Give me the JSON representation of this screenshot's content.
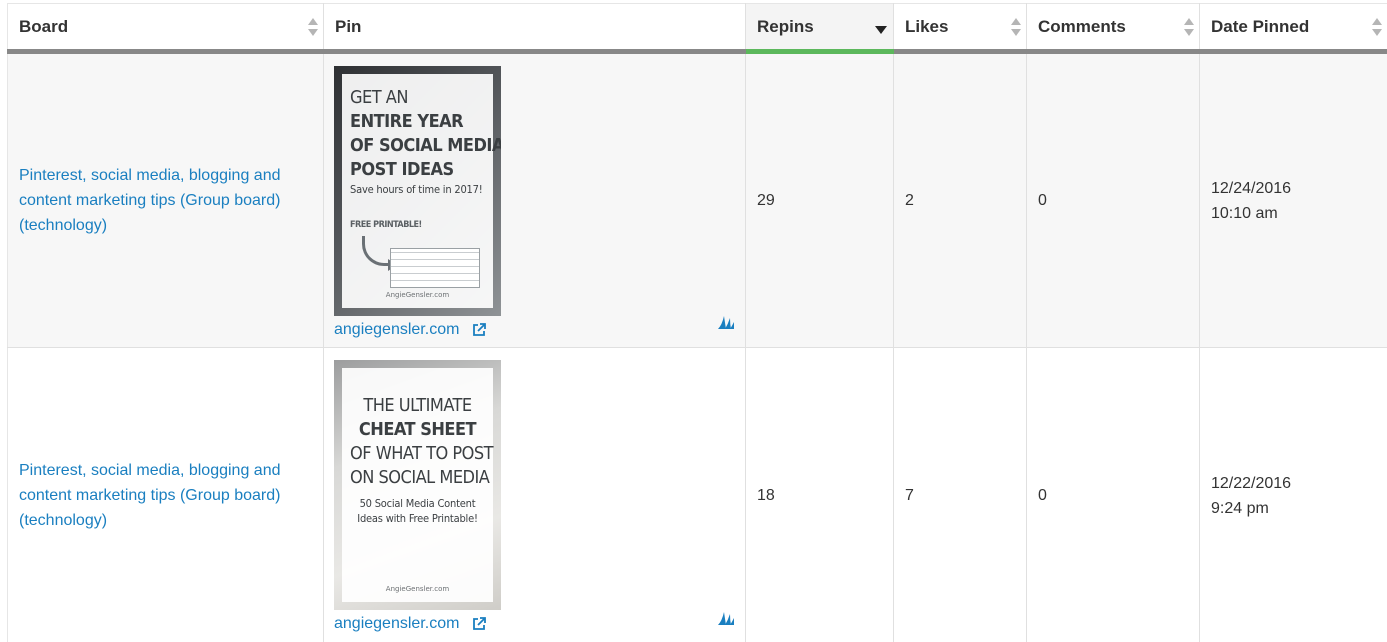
{
  "table": {
    "columns": [
      {
        "label": "Board",
        "sort": "none"
      },
      {
        "label": "Pin",
        "sort": "none"
      },
      {
        "label": "Repins",
        "sort": "desc"
      },
      {
        "label": "Likes",
        "sort": "none"
      },
      {
        "label": "Comments",
        "sort": "none"
      },
      {
        "label": "Date Pinned",
        "sort": "none"
      }
    ],
    "rows": [
      {
        "board": "Pinterest, social media, blogging and content marketing tips (Group board) (technology)",
        "pin": {
          "lines": [
            "GET AN",
            "ENTIRE YEAR",
            "OF SOCIAL MEDIA",
            "POST IDEAS",
            "Save hours of time in 2017!",
            "FREE PRINTABLE!"
          ],
          "credit": "AngieGensler.com",
          "domain": "angiegensler.com"
        },
        "repins": "29",
        "likes": "2",
        "comments": "0",
        "date": "12/24/2016",
        "time": "10:10 am"
      },
      {
        "board": "Pinterest, social media, blogging and content marketing tips (Group board) (technology)",
        "pin": {
          "lines": [
            "THE ULTIMATE",
            "CHEAT SHEET",
            "OF WHAT TO POST",
            "ON SOCIAL MEDIA",
            "50 Social Media Content",
            "Ideas with Free Printable!"
          ],
          "credit": "AngieGensler.com",
          "domain": "angiegensler.com"
        },
        "repins": "18",
        "likes": "7",
        "comments": "0",
        "date": "12/22/2016",
        "time": "9:24 pm"
      }
    ]
  },
  "colors": {
    "link": "#1a7fc0",
    "sorted_underline": "#5cb85c",
    "header_underline": "#888888"
  },
  "icons": {
    "sort": "sort-arrows-icon",
    "sort_desc": "sort-desc-icon",
    "external": "external-link-icon",
    "source": "pinterest-source-icon"
  }
}
